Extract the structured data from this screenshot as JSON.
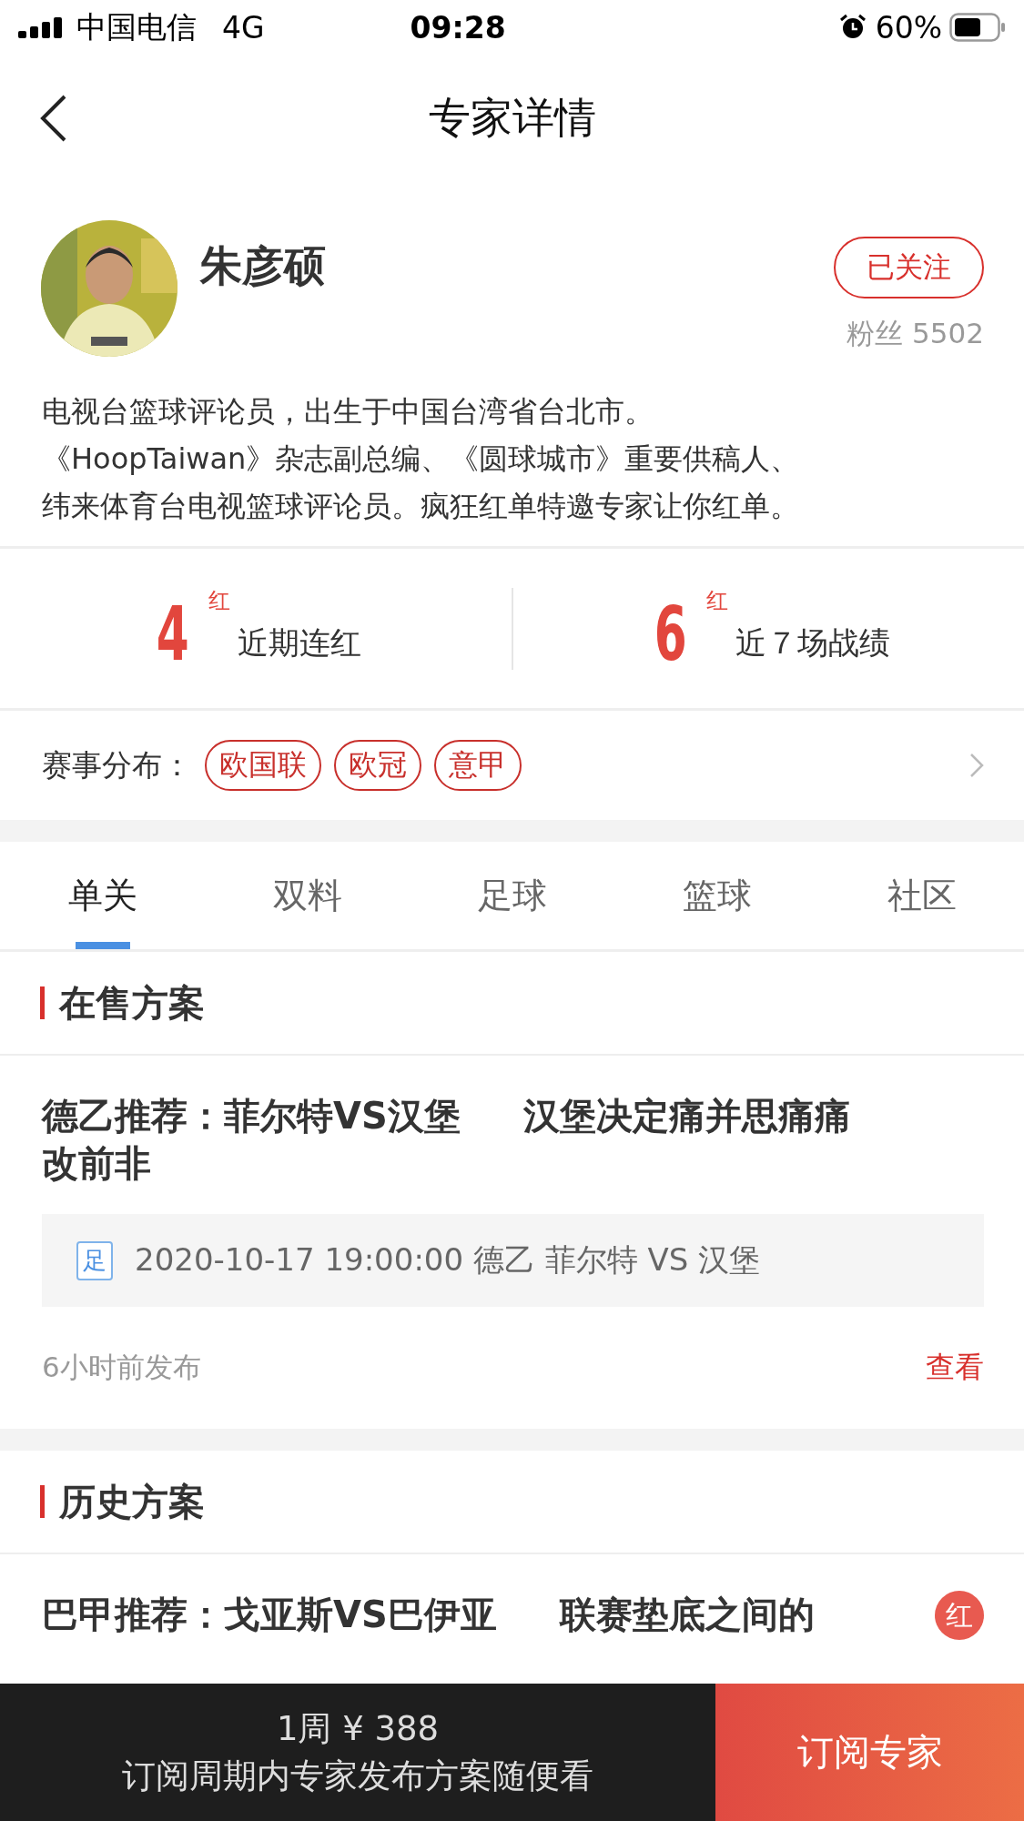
{
  "status_bar": {
    "carrier": "中国电信",
    "network": "4G",
    "time": "09:28",
    "battery": "60%"
  },
  "nav": {
    "title": "专家详情"
  },
  "expert": {
    "name": "朱彦硕",
    "followed": true,
    "follow_label": "已关注",
    "fans": "粉丝 5502",
    "bio_lines": [
      "电视台篮球评论员，出生于中国台湾省台北市。",
      "《HoopTaiwan》杂志副总编、《圆球城市》重要供稿人、",
      "纬来体育台电视篮球评论员。疯狂红单特邀专家让你红单。"
    ]
  },
  "stats": [
    {
      "value": "4",
      "unit": "红",
      "label": "近期连红"
    },
    {
      "value": "6",
      "unit": "红",
      "label": "近７场战绩"
    }
  ],
  "leagues": {
    "label": "赛事分布：",
    "tags": [
      "欧国联",
      "欧冠",
      "意甲"
    ]
  },
  "tabs": [
    {
      "label": "单关",
      "selected": true
    },
    {
      "label": "双料",
      "selected": false
    },
    {
      "label": "足球",
      "selected": false
    },
    {
      "label": "篮球",
      "selected": false
    },
    {
      "label": "社区",
      "selected": false
    }
  ],
  "on_sale": {
    "title": "在售方案",
    "plans": [
      {
        "title": "德乙推荐：菲尔特VS汉堡     汉堡决定痛并思痛痛改前非",
        "sport": "足",
        "match": "2020-10-17 19:00:00 德乙 菲尔特 VS 汉堡",
        "published": "6小时前发布",
        "action": "查看"
      }
    ]
  },
  "history": {
    "title": "历史方案",
    "plans": [
      {
        "title": "巴甲推荐：戈亚斯VS巴伊亚     联赛垫底之间的",
        "result": "红"
      }
    ]
  },
  "footer": {
    "price": "1周 ¥ 388",
    "description": "订阅周期内专家发布方案随便看",
    "subscribe": "订阅专家"
  }
}
